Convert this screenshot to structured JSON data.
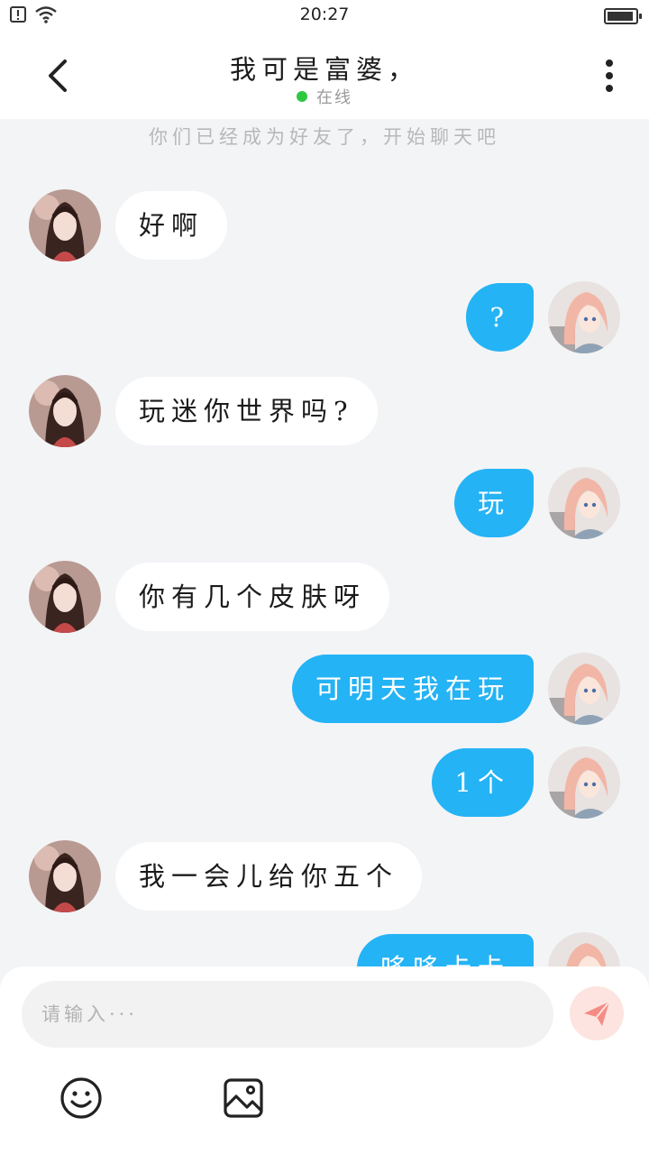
{
  "status_bar": {
    "time": "20:27"
  },
  "header": {
    "title": "我可是富婆，",
    "status": "在线"
  },
  "chat": {
    "system_note": "你们已经成为好友了，开始聊天吧",
    "messages": [
      {
        "side": "left",
        "text": "好啊"
      },
      {
        "side": "right",
        "text": "?"
      },
      {
        "side": "left",
        "text": "玩迷你世界吗?"
      },
      {
        "side": "right",
        "text": "玩"
      },
      {
        "side": "left",
        "text": "你有几个皮肤呀"
      },
      {
        "side": "right",
        "text": "可明天我在玩"
      },
      {
        "side": "right",
        "text": "1个"
      },
      {
        "side": "left",
        "text": "我一会儿给你五个"
      },
      {
        "side": "right",
        "text": "哆哆卡卡"
      }
    ]
  },
  "input": {
    "placeholder": "请输入···"
  },
  "icons": {
    "back": "chevron-left-icon",
    "more": "more-vertical-icon",
    "send": "send-icon",
    "emoji": "smiley-icon",
    "image": "image-icon"
  },
  "colors": {
    "accent": "#24b3f5",
    "online": "#2ec840",
    "send_bg": "#fde4e0",
    "send_icon": "#f58c84"
  }
}
